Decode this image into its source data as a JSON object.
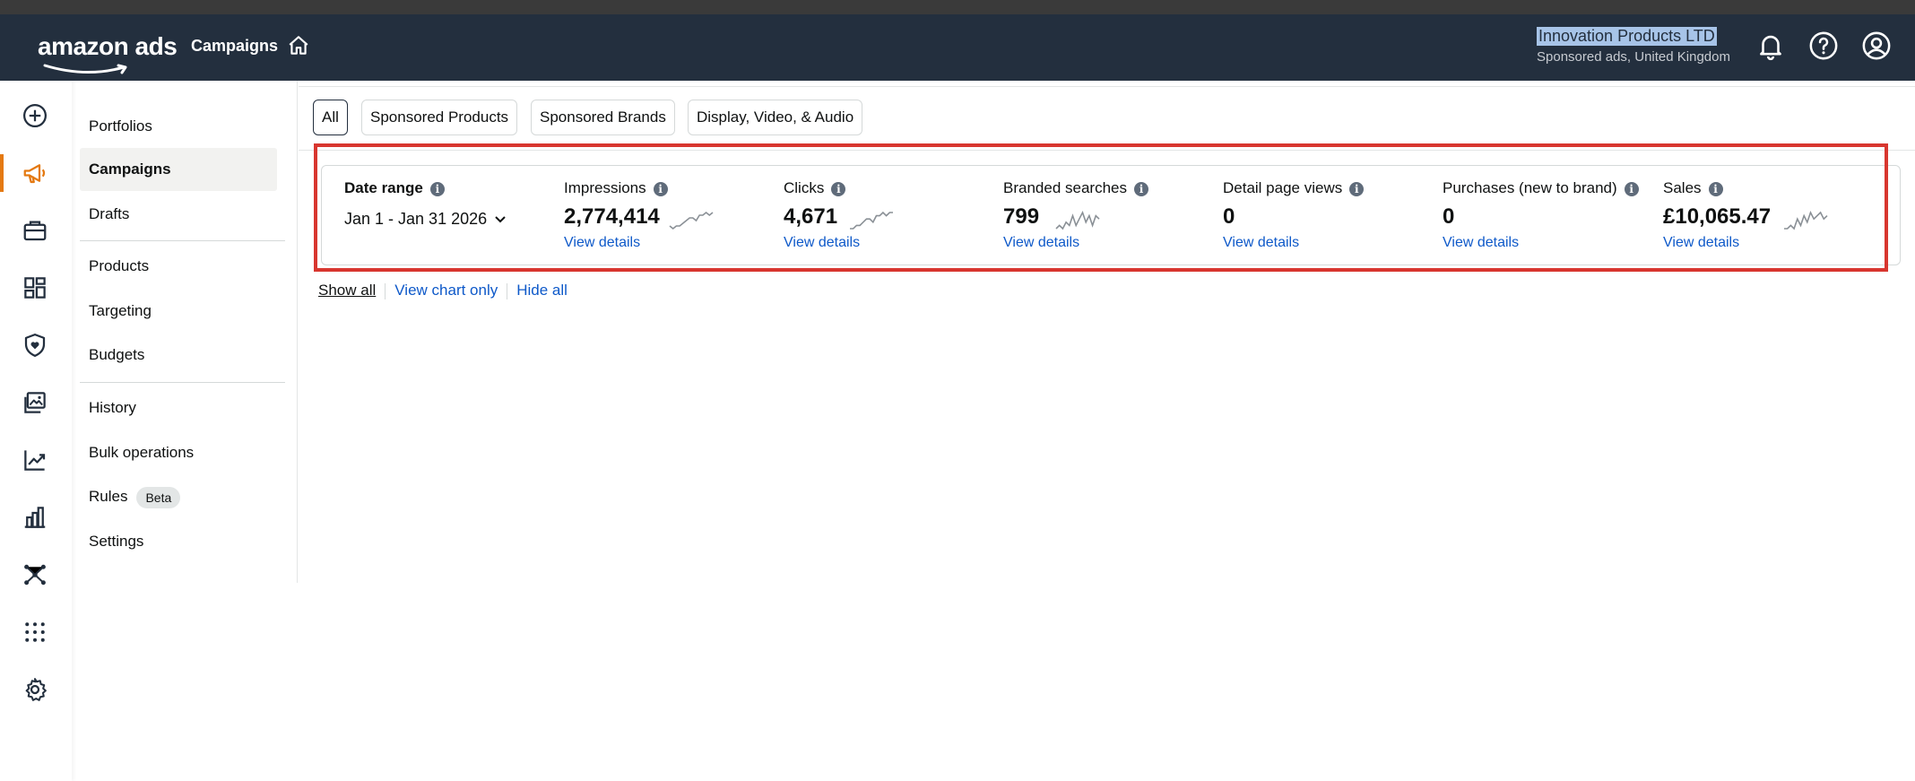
{
  "header": {
    "logo_text": "amazon ads",
    "section_title": "Campaigns",
    "account_name": "Innovation Products LTD",
    "account_sub": "Sponsored ads, United Kingdom"
  },
  "rail": {
    "icons": [
      "plus-circle-icon",
      "megaphone-icon",
      "briefcase-icon",
      "dashboard-icon",
      "shield-heart-icon",
      "images-icon",
      "line-chart-icon",
      "bar-chart-icon",
      "network-icon",
      "apps-grid-icon",
      "gear-icon"
    ],
    "active_color": "#e47911"
  },
  "nav": {
    "items": [
      {
        "label": "Portfolios"
      },
      {
        "label": "Campaigns"
      },
      {
        "label": "Drafts"
      },
      {
        "label": "Products"
      },
      {
        "label": "Targeting"
      },
      {
        "label": "Budgets"
      },
      {
        "label": "History"
      },
      {
        "label": "Bulk operations"
      },
      {
        "label": "Rules",
        "badge": "Beta"
      },
      {
        "label": "Settings"
      }
    ]
  },
  "filters": {
    "pills": [
      "All",
      "Sponsored Products",
      "Sponsored Brands",
      "Display, Video, & Audio"
    ],
    "selected": "All"
  },
  "metrics": {
    "date_range_label": "Date range",
    "date_range_value": "Jan 1 - Jan 31 2026",
    "items": [
      {
        "label": "Impressions",
        "value": "2,774,414",
        "link": "View details",
        "spark": [
          6,
          7,
          6,
          6,
          5,
          4,
          3,
          3,
          4,
          2,
          2,
          1,
          2,
          1
        ]
      },
      {
        "label": "Clicks",
        "value": "4,671",
        "link": "View details",
        "spark": [
          6,
          6,
          5,
          5,
          4,
          3,
          3,
          4,
          2,
          2,
          1,
          2,
          1,
          1
        ]
      },
      {
        "label": "Branded searches",
        "value": "799",
        "link": "View details",
        "spark": [
          6,
          5,
          6,
          4,
          5,
          2,
          5,
          3,
          1,
          4,
          2,
          5,
          2,
          3
        ]
      },
      {
        "label": "Detail page views",
        "value": "0",
        "link": "View details"
      },
      {
        "label": "Purchases (new to brand)",
        "value": "0",
        "link": "View details"
      },
      {
        "label": "Sales",
        "value": "£10,065.47",
        "link": "View details",
        "spark": [
          6,
          6,
          5,
          6,
          3,
          5,
          2,
          4,
          1,
          3,
          2,
          1,
          3,
          2
        ]
      }
    ],
    "highlight_color": "#d8362f"
  },
  "view_links": {
    "show_all": "Show all",
    "view_chart_only": "View chart only",
    "hide_all": "Hide all"
  }
}
